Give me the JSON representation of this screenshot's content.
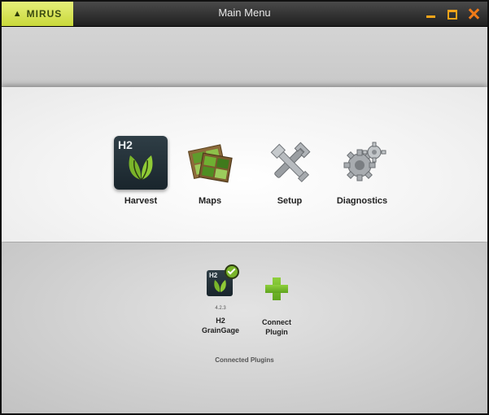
{
  "titlebar": {
    "brand": "MIRUS",
    "title": "Main Menu"
  },
  "menu": {
    "items": [
      {
        "label": "Harvest",
        "icon": "h2-harvest-icon",
        "badge": "H2"
      },
      {
        "label": "Maps",
        "icon": "maps-icon"
      },
      {
        "label": "Setup",
        "icon": "setup-wrench-icon"
      },
      {
        "label": "Diagnostics",
        "icon": "diagnostics-gears-icon"
      }
    ]
  },
  "plugins": {
    "items": [
      {
        "name_line1": "H2",
        "name_line2": "GrainGage",
        "version": "4.2.3",
        "badge": "H2",
        "connected": true
      },
      {
        "name_line1": "Connect",
        "name_line2": "Plugin"
      }
    ],
    "caption": "Connected Plugins"
  },
  "colors": {
    "brand_bg": "#d4e04f",
    "titlebar_bg": "#2e2e2e",
    "window_controls": "#f3a41a",
    "h2_tile": "#233038",
    "leaf_green": "#7ab52a",
    "plus_green": "#6cb82a"
  }
}
